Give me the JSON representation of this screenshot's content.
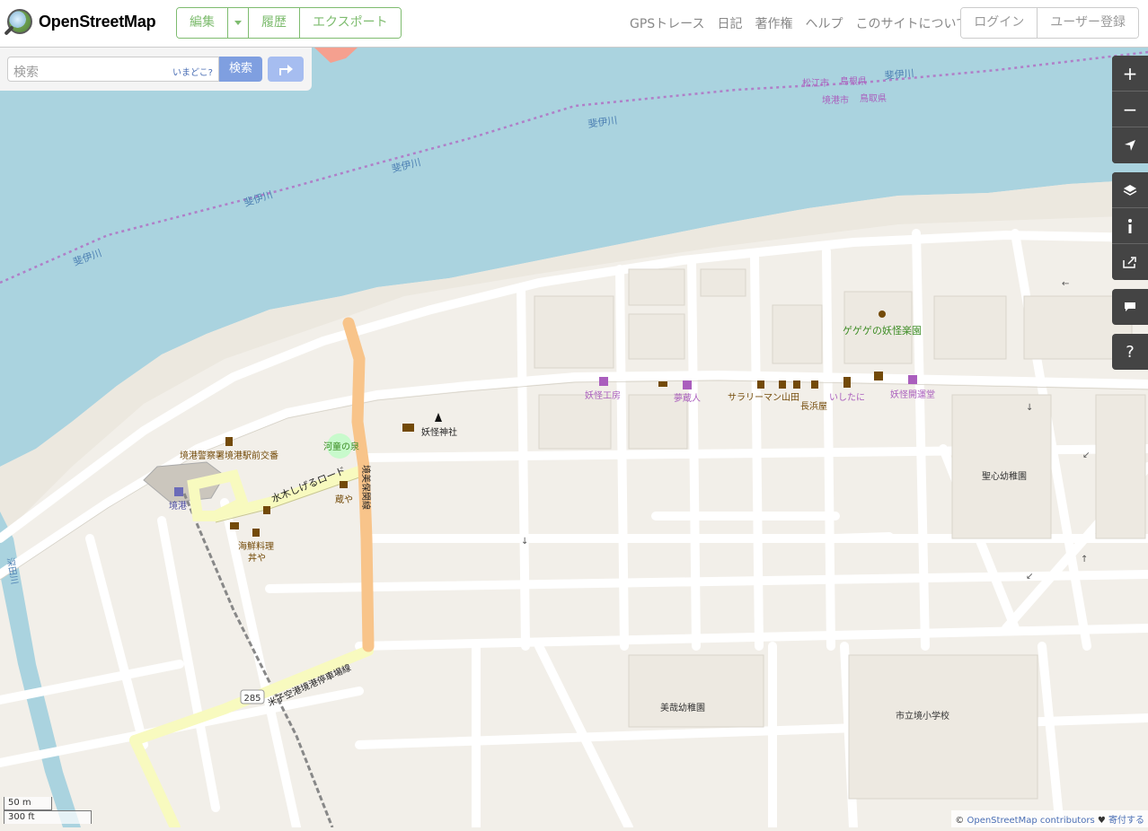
{
  "header": {
    "logo_text": "OpenStreetMap",
    "edit_label": "編集",
    "history_label": "履歴",
    "export_label": "エクスポート",
    "nav": [
      "GPSトレース",
      "日記",
      "著作権",
      "ヘルプ",
      "このサイトについて"
    ],
    "login_label": "ログイン",
    "signup_label": "ユーザー登録"
  },
  "search": {
    "placeholder": "検索",
    "where_am_i": "いまどこ?",
    "button_label": "検索"
  },
  "map": {
    "water_labels": [
      "斐伊川",
      "斐伊川",
      "斐伊川",
      "斐伊川",
      "斐伊川"
    ],
    "boundary_labels": {
      "top_left": "松江市",
      "top_right": "島根県",
      "bottom_left": "境港市",
      "bottom_right": "鳥取県"
    },
    "river_small": "深田川",
    "roads": {
      "mizuki": "水木しげるロード",
      "sakai_line": "境美保関線",
      "yonago": "米子空港境港停車場線",
      "route_number": "285"
    },
    "pois": {
      "police": "境港警察署境港駅前交番",
      "station": "境港",
      "kappa": "河童の泉",
      "kuraya": "蔵や",
      "seafood_1": "海鮮料理",
      "seafood_2": "丼や",
      "shrine": "妖怪神社",
      "yokai_kobo": "妖怪工房",
      "yumekurabito": "夢蔵人",
      "salaryman": "サラリーマン山田",
      "nagahamaya": "長浜屋",
      "ishitani": "いしたに",
      "kaiundo": "妖怪開運堂",
      "gegege": "ゲゲゲの妖怪楽園",
      "seishin": "聖心幼稚園",
      "misai": "美哉幼稚園",
      "school": "市立境小学校"
    },
    "colors": {
      "water": "#aad3df",
      "land": "#f2efe9",
      "pink": "#aa5ebd",
      "brown": "#734a08",
      "green": "#3c8c24",
      "tertiary": "#f8fabf",
      "secondary": "#f8c48a"
    }
  },
  "controls": {
    "zoom_in": "+",
    "zoom_out": "−",
    "help": "?"
  },
  "scale": {
    "metric": "50 m",
    "imperial": "300 ft"
  },
  "attribution": {
    "prefix": "©",
    "link": "OpenStreetMap contributors",
    "heart": "♥",
    "donate": "寄付する"
  }
}
